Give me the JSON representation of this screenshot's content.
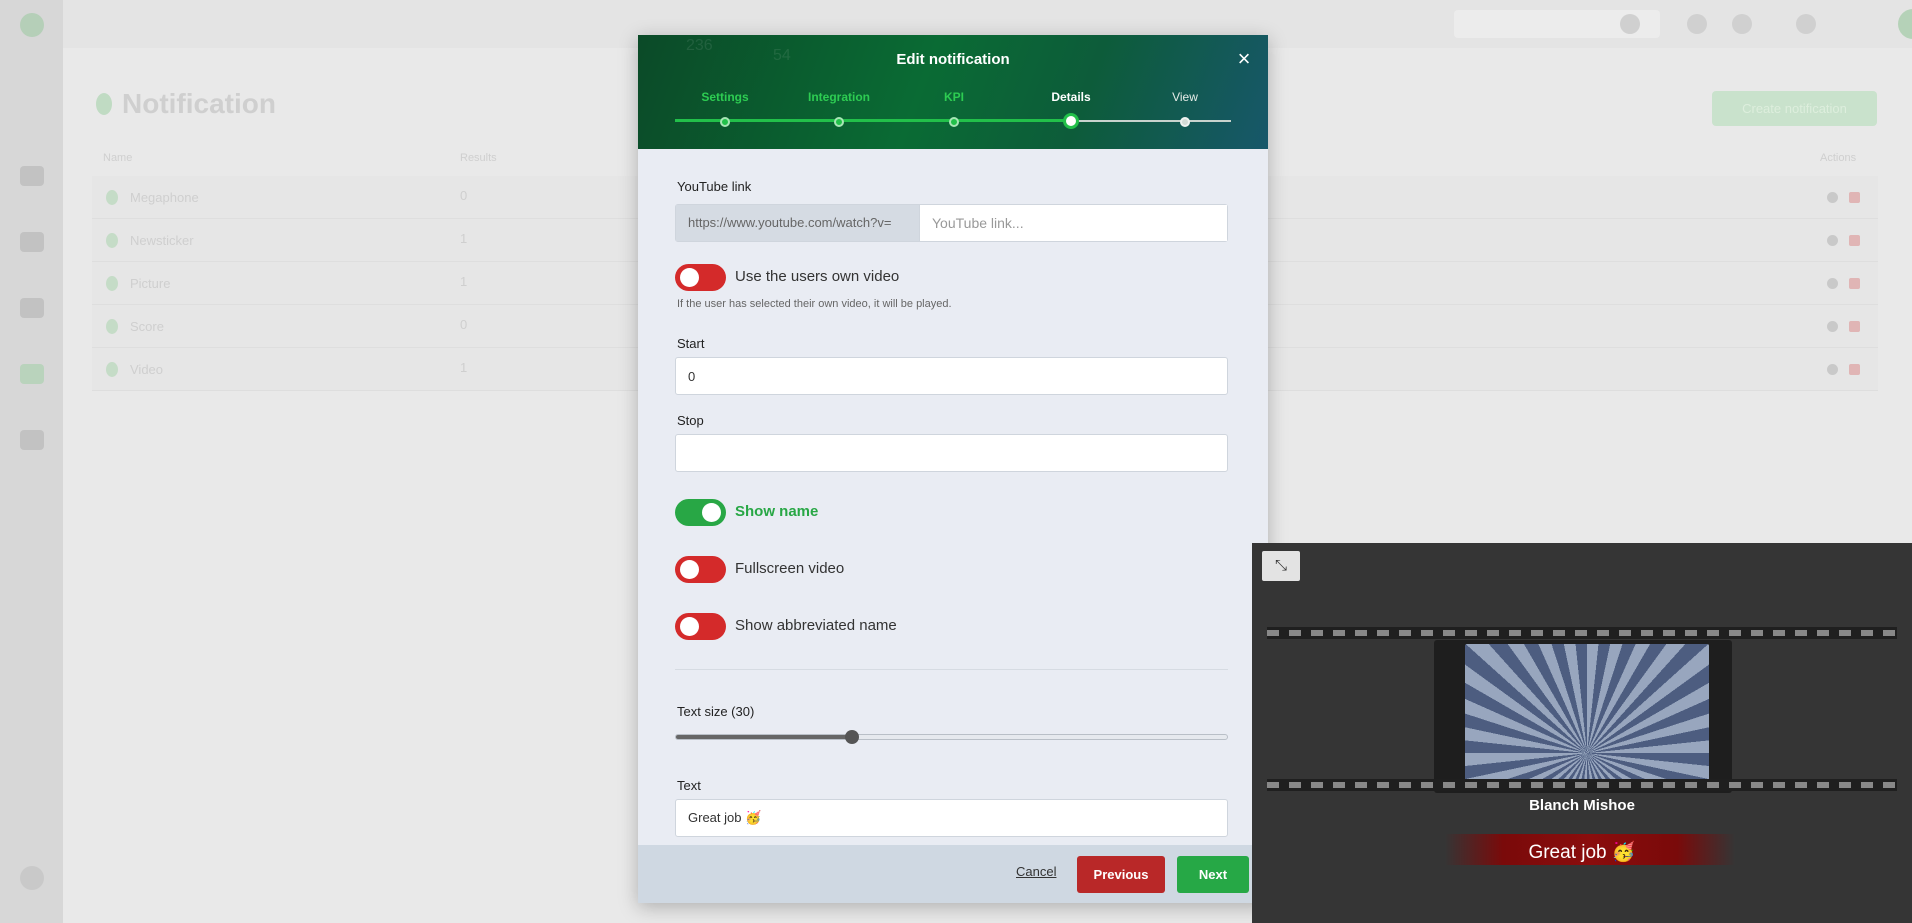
{
  "background": {
    "page_title": "Notification",
    "create_button": "Create notification",
    "columns": [
      "Name",
      "Results",
      "Actions"
    ],
    "rows": [
      {
        "name": "Megaphone",
        "value": "0"
      },
      {
        "name": "Newsticker",
        "value": "1"
      },
      {
        "name": "Picture",
        "value": "1"
      },
      {
        "name": "Score",
        "value": "0"
      },
      {
        "name": "Video",
        "value": "1"
      }
    ]
  },
  "modal": {
    "title": "Edit notification",
    "close_icon": "close-icon",
    "steps": [
      {
        "label": "Settings",
        "state": "done"
      },
      {
        "label": "Integration",
        "state": "done"
      },
      {
        "label": "KPI",
        "state": "done"
      },
      {
        "label": "Details",
        "state": "current"
      },
      {
        "label": "View",
        "state": "todo"
      }
    ],
    "youtube": {
      "label": "YouTube link",
      "prefix": "https://www.youtube.com/watch?v=",
      "placeholder": "YouTube link...",
      "value": ""
    },
    "own_video": {
      "label": "Use the users own video",
      "on": false,
      "hint": "If the user has selected their own video, it will be played."
    },
    "start": {
      "label": "Start",
      "value": "0"
    },
    "stop": {
      "label": "Stop",
      "value": ""
    },
    "show_name": {
      "label": "Show name",
      "on": true
    },
    "fullscreen": {
      "label": "Fullscreen video",
      "on": false
    },
    "abbreviated": {
      "label": "Show abbreviated name",
      "on": false
    },
    "text_size": {
      "label": "Text size (30)",
      "value": 30,
      "fraction": 0.32
    },
    "text": {
      "label": "Text",
      "value": "Great job 🥳"
    },
    "footer": {
      "cancel": "Cancel",
      "previous": "Previous",
      "next": "Next"
    }
  },
  "preview": {
    "minimize_icon": "minimize-icon",
    "name": "Blanch Mishoe",
    "text": "Great job 🥳"
  },
  "colors": {
    "accent_green": "#28a745",
    "danger_red": "#d42a2a",
    "header_green": "#0a6b34"
  }
}
